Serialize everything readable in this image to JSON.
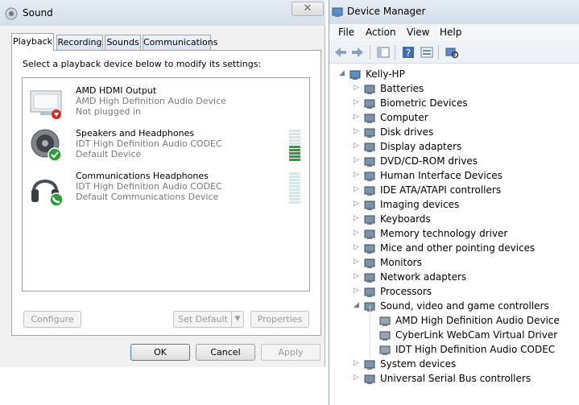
{
  "sound": {
    "title": "Sound",
    "close_glyph": "✕",
    "tabs": [
      "Playback",
      "Recording",
      "Sounds",
      "Communications"
    ],
    "instruction": "Select a playback device below to modify its settings:",
    "devices": [
      {
        "name": "AMD HDMI Output",
        "driver": "AMD High Definition Audio Device",
        "status": "Not plugged in",
        "icon": "monitor-speaker-icon",
        "badge": "red-down-arrow"
      },
      {
        "name": "Speakers and Headphones",
        "driver": "IDT High Definition Audio CODEC",
        "status": "Default Device",
        "icon": "speaker-icon",
        "badge": "green-check"
      },
      {
        "name": "Communications Headphones",
        "driver": "IDT High Definition Audio CODEC",
        "status": "Default Communications Device",
        "icon": "headphones-icon",
        "badge": "green-phone"
      }
    ],
    "buttons": {
      "configure": "Configure",
      "set_default": "Set Default",
      "properties": "Properties",
      "ok": "OK",
      "cancel": "Cancel",
      "apply": "Apply"
    }
  },
  "device_manager": {
    "title": "Device Manager",
    "menu": [
      "File",
      "Action",
      "View",
      "Help"
    ],
    "root": "Kelly-HP",
    "categories": [
      "Batteries",
      "Biometric Devices",
      "Computer",
      "Disk drives",
      "Display adapters",
      "DVD/CD-ROM drives",
      "Human Interface Devices",
      "IDE ATA/ATAPI controllers",
      "Imaging devices",
      "Keyboards",
      "Memory technology driver",
      "Mice and other pointing devices",
      "Monitors",
      "Network adapters",
      "Processors",
      "Sound, video and game controllers"
    ],
    "sound_children": [
      "AMD High Definition Audio Device",
      "CyberLink WebCam Virtual Driver",
      "IDT High Definition Audio CODEC"
    ],
    "after_categories": [
      "System devices",
      "Universal Serial Bus controllers"
    ]
  },
  "colors": {
    "meter_on": "#2f9c3a",
    "meter_off": "#d7e4ea",
    "title_bar": "#dce4ee"
  }
}
